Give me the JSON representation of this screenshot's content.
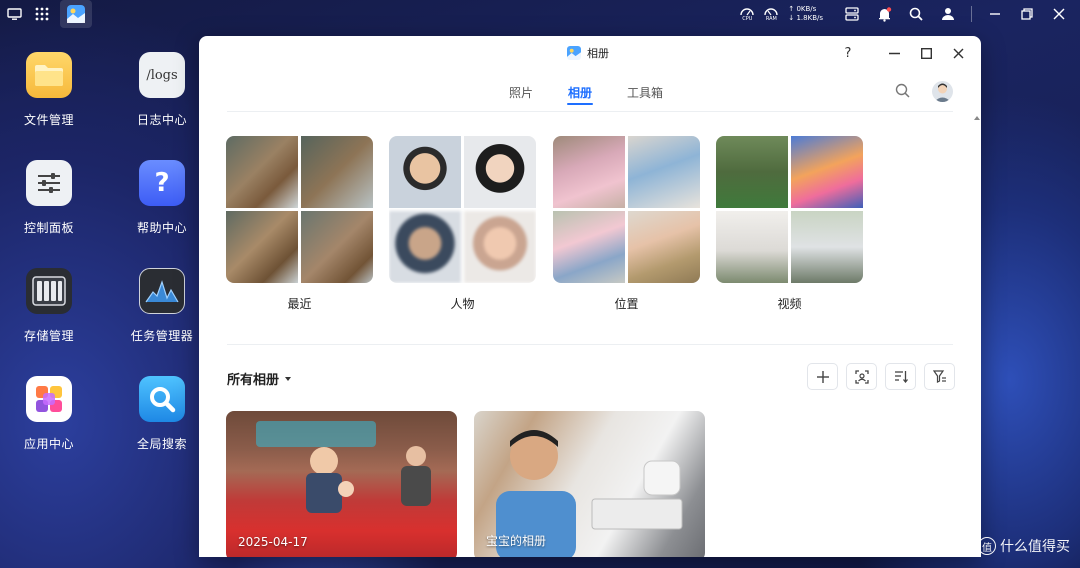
{
  "desktop": {
    "icons": [
      {
        "label": "文件管理"
      },
      {
        "label": "日志中心",
        "tile_text": "/logs"
      },
      {
        "label": "控制面板"
      },
      {
        "label": "帮助中心",
        "tile_text": "?"
      },
      {
        "label": "存储管理"
      },
      {
        "label": "任务管理器"
      },
      {
        "label": "应用中心"
      },
      {
        "label": "全局搜索"
      }
    ]
  },
  "topbar": {
    "cpu_label": "CPU",
    "ram_label": "RAM",
    "upload": "↑ 0KB/s",
    "download": "↓ 1.8KB/s"
  },
  "window": {
    "title": "相册",
    "help": "?",
    "tabs": [
      {
        "label": "照片"
      },
      {
        "label": "相册"
      },
      {
        "label": "工具箱"
      }
    ],
    "categories": [
      {
        "label": "最近"
      },
      {
        "label": "人物"
      },
      {
        "label": "位置"
      },
      {
        "label": "视频"
      }
    ],
    "section_title": "所有相册",
    "albums": [
      {
        "date": "2025-04-17"
      },
      {
        "name": "宝宝的相册"
      }
    ]
  },
  "watermark": {
    "badge": "值",
    "text": "什么值得买"
  },
  "colors": {
    "accent": "#1e6fff",
    "window_bg": "#ffffff",
    "desktop_bg": "#1a2460"
  }
}
